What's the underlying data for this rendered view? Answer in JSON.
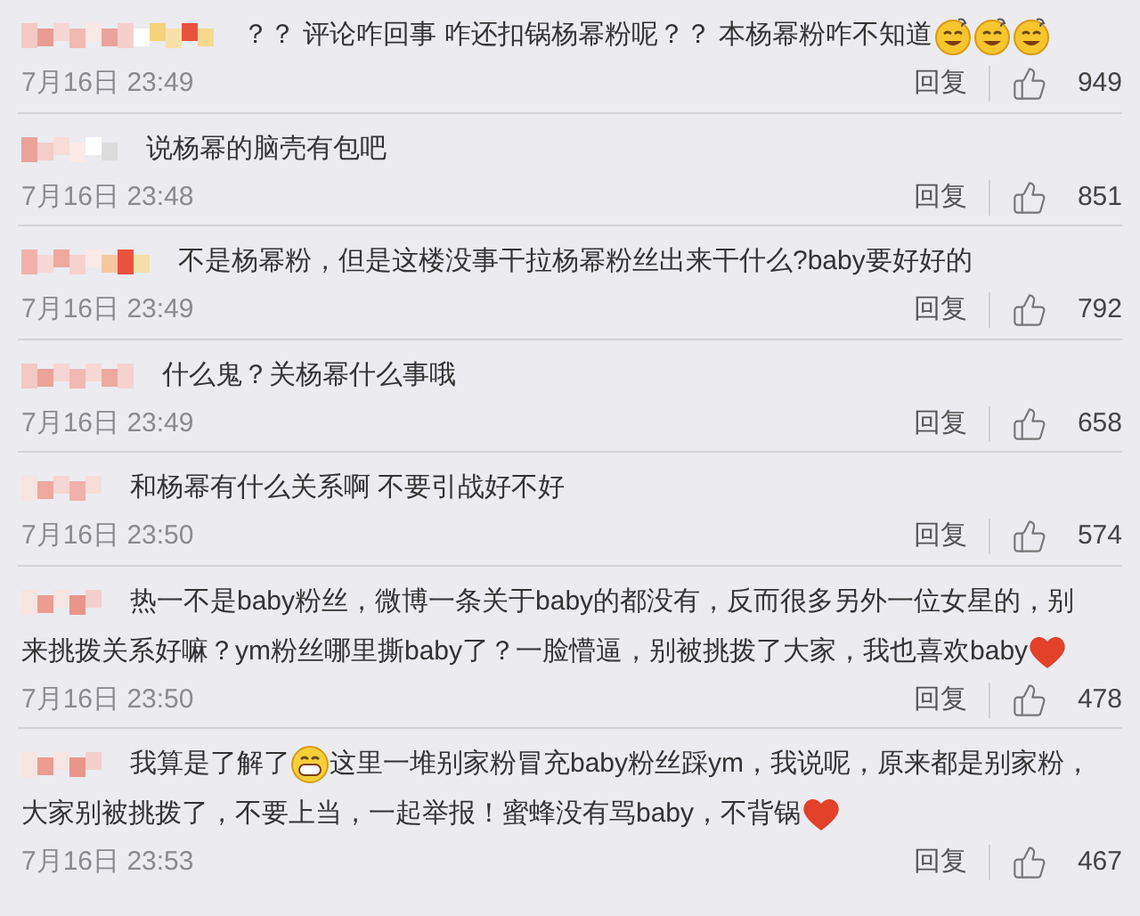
{
  "comments": [
    {
      "lines": [
        [
          {
            "kind": "text",
            "text": "？？ 评论咋回事 咋还扣锅杨幂粉呢？？ 本杨幂粉咋不知道"
          },
          {
            "kind": "emoji-dizzy"
          },
          {
            "kind": "emoji-dizzy"
          },
          {
            "kind": "emoji-dizzy"
          }
        ]
      ],
      "time": "7月16日 23:49",
      "reply": "回复",
      "likes": "949"
    },
    {
      "lines": [
        [
          {
            "kind": "text",
            "text": "说杨幂的脑壳有包吧"
          }
        ]
      ],
      "time": "7月16日 23:48",
      "reply": "回复",
      "likes": "851"
    },
    {
      "lines": [
        [
          {
            "kind": "text",
            "text": "不是杨幂粉，但是这楼没事干拉杨幂粉丝出来干什么?baby要好好的"
          }
        ]
      ],
      "time": "7月16日 23:49",
      "reply": "回复",
      "likes": "792"
    },
    {
      "lines": [
        [
          {
            "kind": "text",
            "text": "什么鬼？关杨幂什么事哦"
          }
        ]
      ],
      "time": "7月16日 23:49",
      "reply": "回复",
      "likes": "658"
    },
    {
      "lines": [
        [
          {
            "kind": "text",
            "text": "和杨幂有什么关系啊 不要引战好不好"
          }
        ]
      ],
      "time": "7月16日 23:50",
      "reply": "回复",
      "likes": "574"
    },
    {
      "lines": [
        [
          {
            "kind": "text",
            "text": "热一不是baby粉丝，微博一条关于baby的都没有，反而很多另外一位女星的，别"
          }
        ],
        [
          {
            "kind": "text",
            "text": "来挑拨关系好嘛？ym粉丝哪里撕baby了？一脸懵逼，别被挑拨了大家，我也喜欢baby"
          },
          {
            "kind": "emoji-heart"
          }
        ]
      ],
      "time": "7月16日 23:50",
      "reply": "回复",
      "likes": "478"
    },
    {
      "lines": [
        [
          {
            "kind": "text",
            "text": "我算是了解了"
          },
          {
            "kind": "emoji-grin"
          },
          {
            "kind": "text",
            "text": "这里一堆别家粉冒充baby粉丝踩ym，我说呢，原来都是别家粉，"
          }
        ],
        [
          {
            "kind": "text",
            "text": "大家别被挑拨了，不要上当，一起举报！蜜蜂没有骂baby，不背锅"
          },
          {
            "kind": "emoji-heart"
          }
        ]
      ],
      "time": "7月16日 23:53",
      "reply": "回复",
      "likes": "467"
    }
  ]
}
